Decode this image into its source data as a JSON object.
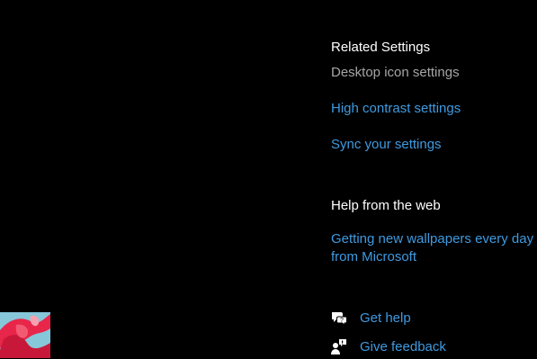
{
  "related_settings": {
    "heading": "Related Settings",
    "items": [
      {
        "label": "Desktop icon settings",
        "enabled": false
      },
      {
        "label": "High contrast settings",
        "enabled": true
      },
      {
        "label": "Sync your settings",
        "enabled": true
      }
    ]
  },
  "help_web": {
    "heading": "Help from the web",
    "link": "Getting new wallpapers every day from Microsoft"
  },
  "actions": {
    "get_help": {
      "label": "Get help",
      "icon": "chat-help-icon"
    },
    "give_feedback": {
      "label": "Give feedback",
      "icon": "feedback-person-icon"
    }
  },
  "colors": {
    "background": "#000000",
    "link": "#3f9ae0",
    "disabled": "#a6a6a6",
    "heading": "#ffffff"
  }
}
